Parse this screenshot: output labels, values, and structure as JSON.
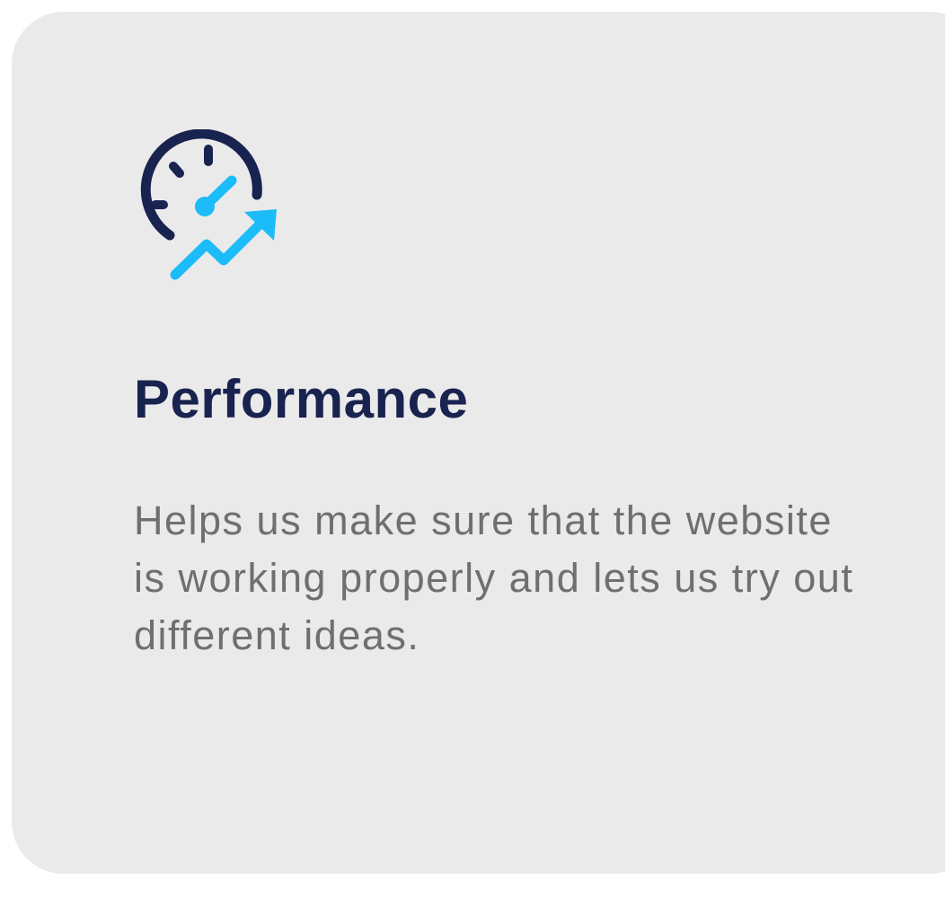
{
  "card": {
    "icon": "speedometer-trend-up-icon",
    "title": "Performance",
    "description": "Helps us make sure that the website is working properly and lets us try out different ideas."
  },
  "colors": {
    "card_background": "#eaeaeb",
    "title": "#19234f",
    "description": "#6f6f6f",
    "icon_dark": "#19234f",
    "icon_accent": "#1bbcf7"
  }
}
